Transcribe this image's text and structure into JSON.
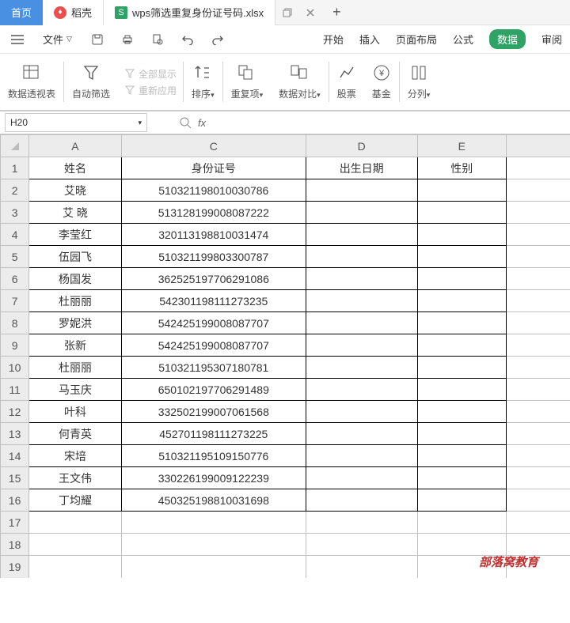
{
  "titlebar": {
    "home": "首页",
    "docx": "稻壳",
    "file_icon": "S",
    "file_name": "wps筛选重复身份证号码.xlsx"
  },
  "toolbar": {
    "file_label": "文件",
    "menu": {
      "start": "开始",
      "insert": "插入",
      "layout": "页面布局",
      "formula": "公式",
      "data": "数据",
      "review": "审阅"
    }
  },
  "ribbon": {
    "pivot": "数据透视表",
    "filter": "自动筛选",
    "show_all": "全部显示",
    "reapply": "重新应用",
    "sort": "排序",
    "dup": "重复项",
    "compare": "数据对比",
    "stock": "股票",
    "fund": "基金",
    "split": "分列"
  },
  "namebox": {
    "value": "H20",
    "fx": "fx"
  },
  "grid": {
    "cols": [
      "A",
      "C",
      "D",
      "E",
      ""
    ],
    "headers": {
      "A": "姓名",
      "C": "身份证号",
      "D": "出生日期",
      "E": "性别"
    },
    "rows": [
      {
        "n": "1",
        "A": "姓名",
        "C": "身份证号",
        "D": "出生日期",
        "E": "性别"
      },
      {
        "n": "2",
        "A": "艾晓",
        "C": "510321198010030786",
        "D": "",
        "E": ""
      },
      {
        "n": "3",
        "A": "艾 晓",
        "C": "513128199008087222",
        "D": "",
        "E": ""
      },
      {
        "n": "4",
        "A": "李莹红",
        "C": "320113198810031474",
        "D": "",
        "E": ""
      },
      {
        "n": "5",
        "A": "伍园飞",
        "C": "510321199803300787",
        "D": "",
        "E": ""
      },
      {
        "n": "6",
        "A": "杨国发",
        "C": "362525197706291086",
        "D": "",
        "E": ""
      },
      {
        "n": "7",
        "A": "杜丽丽",
        "C": "542301198111273235",
        "D": "",
        "E": ""
      },
      {
        "n": "8",
        "A": "罗妮洪",
        "C": "542425199008087707",
        "D": "",
        "E": ""
      },
      {
        "n": "9",
        "A": "张新",
        "C": "542425199008087707",
        "D": "",
        "E": ""
      },
      {
        "n": "10",
        "A": "杜丽丽",
        "C": "510321195307180781",
        "D": "",
        "E": ""
      },
      {
        "n": "11",
        "A": "马玉庆",
        "C": "650102197706291489",
        "D": "",
        "E": ""
      },
      {
        "n": "12",
        "A": "叶科",
        "C": "332502199007061568",
        "D": "",
        "E": ""
      },
      {
        "n": "13",
        "A": "何青英",
        "C": "452701198111273225",
        "D": "",
        "E": ""
      },
      {
        "n": "14",
        "A": "宋培",
        "C": "510321195109150776",
        "D": "",
        "E": ""
      },
      {
        "n": "15",
        "A": "王文伟",
        "C": "330226199009122239",
        "D": "",
        "E": ""
      },
      {
        "n": "16",
        "A": "丁均耀",
        "C": "450325198810031698",
        "D": "",
        "E": ""
      },
      {
        "n": "17",
        "A": "",
        "C": "",
        "D": "",
        "E": ""
      },
      {
        "n": "18",
        "A": "",
        "C": "",
        "D": "",
        "E": ""
      },
      {
        "n": "19",
        "A": "",
        "C": "",
        "D": "",
        "E": ""
      }
    ]
  },
  "watermark": "部落窝教育"
}
